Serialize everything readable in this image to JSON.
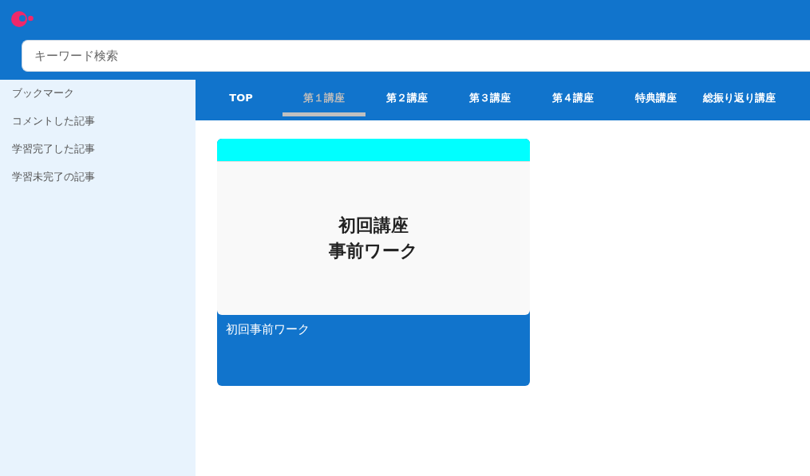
{
  "header": {
    "search": {
      "placeholder": "キーワード検索"
    }
  },
  "sidebar": {
    "items": [
      {
        "label": "ブックマーク"
      },
      {
        "label": "コメントした記事"
      },
      {
        "label": "学習完了した記事"
      },
      {
        "label": "学習未完了の記事"
      }
    ]
  },
  "tabs": [
    {
      "label": "TOP",
      "selected": false
    },
    {
      "label": "第１講座",
      "selected": true
    },
    {
      "label": "第２講座",
      "selected": false
    },
    {
      "label": "第３講座",
      "selected": false
    },
    {
      "label": "第４講座",
      "selected": false
    },
    {
      "label": "特典講座",
      "selected": false
    },
    {
      "label": "総振り返り講座",
      "selected": false
    }
  ],
  "cards": [
    {
      "thumbnail_lines": [
        "初回講座",
        "事前ワーク"
      ],
      "title": "初回事前ワーク",
      "color": "#00ffff"
    }
  ]
}
